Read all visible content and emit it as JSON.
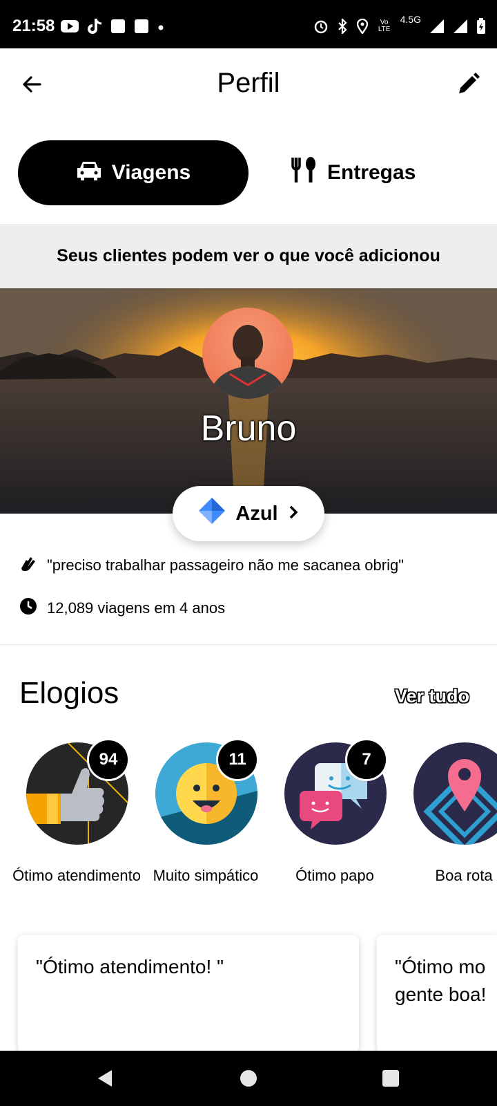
{
  "status_bar": {
    "time": "21:58",
    "network": "4.5G",
    "volte": "Vo LTE"
  },
  "header": {
    "title": "Perfil"
  },
  "tabs": [
    {
      "label": "Viagens",
      "icon": "car-icon",
      "selected": true
    },
    {
      "label": "Entregas",
      "icon": "fork-knife-icon",
      "selected": false
    }
  ],
  "info_banner": "Seus clientes podem ver o que você adicionou",
  "profile": {
    "name": "Bruno",
    "tier": "Azul",
    "tier_color": "#3d8bfd",
    "bio": "\"preciso trabalhar passageiro não me sacanea  obrig\"",
    "trips": "12,089 viagens em 4 anos"
  },
  "compliments": {
    "title": "Elogios",
    "see_all": "Ver tudo",
    "items": [
      {
        "count": "94",
        "label": "Ótimo atendimento"
      },
      {
        "count": "11",
        "label": "Muito simpático"
      },
      {
        "count": "7",
        "label": "Ótimo papo"
      },
      {
        "count": "",
        "label": "Boa rota"
      }
    ]
  },
  "reviews": [
    {
      "text": "\"Ótimo atendimento! \""
    },
    {
      "text": "\"Ótimo mo gente boa!"
    }
  ]
}
